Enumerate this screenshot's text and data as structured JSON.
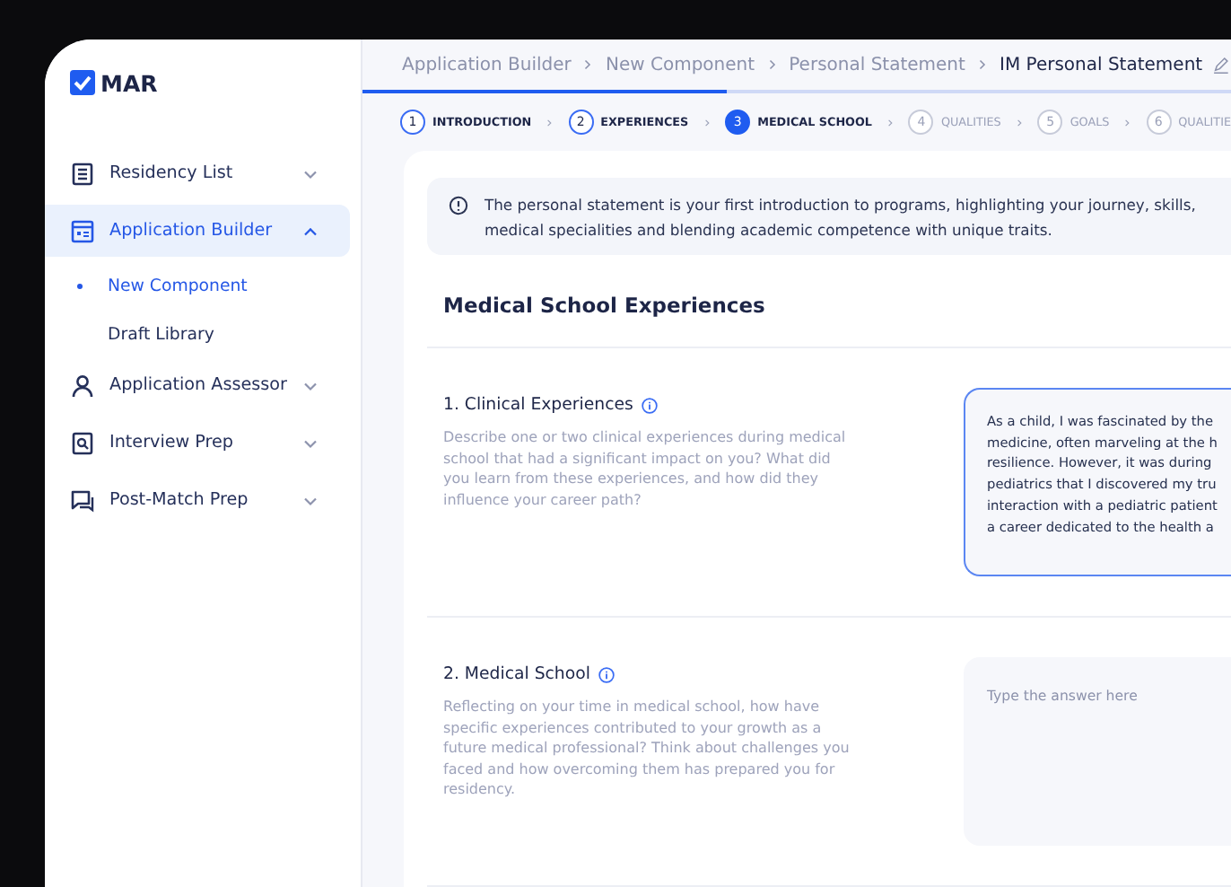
{
  "logo": {
    "text": "MAR"
  },
  "sidebar": {
    "items": [
      {
        "label": "Residency List",
        "kind": "list",
        "expanded": false,
        "selected": false
      },
      {
        "label": "Application Builder",
        "kind": "builder",
        "expanded": true,
        "selected": true,
        "children": [
          {
            "label": "New Component",
            "selected": true
          },
          {
            "label": "Draft Library",
            "selected": false
          }
        ]
      },
      {
        "label": "Application Assessor",
        "kind": "person",
        "expanded": false,
        "selected": false
      },
      {
        "label": "Interview Prep",
        "kind": "review",
        "expanded": false,
        "selected": false
      },
      {
        "label": "Post-Match Prep",
        "kind": "chat",
        "expanded": false,
        "selected": false
      }
    ]
  },
  "breadcrumb": [
    "Application Builder",
    "New Component",
    "Personal Statement",
    "IM Personal Statement"
  ],
  "progress": {
    "level": 0.42
  },
  "steps": [
    {
      "number": "1",
      "label": "INTRODUCTION",
      "completed": true,
      "selected": false
    },
    {
      "number": "2",
      "label": "EXPERIENCES",
      "completed": true,
      "selected": false
    },
    {
      "number": "3",
      "label": "MEDICAL SCHOOL",
      "completed": false,
      "selected": true
    },
    {
      "number": "4",
      "label": "QUALITIES",
      "completed": false,
      "selected": false
    },
    {
      "number": "5",
      "label": "GOALS",
      "completed": false,
      "selected": false
    },
    {
      "number": "6",
      "label": "QUALITIE",
      "completed": false,
      "selected": false
    }
  ],
  "info": "The personal statement is your first introduction to programs, highlighting your journey, skills,",
  "info_line_2": "medical specialities and blending academic competence with unique traits.",
  "section_title": "Medical School Experiences",
  "questions": [
    {
      "title": "1. Clinical Experiences",
      "description": "Describe one or two clinical experiences during medical school that had a significant impact on you? What did you learn from these experiences, and how did they influence your career path?",
      "focused": true,
      "answer_lines": [
        "As a child, I was fascinated by the",
        "medicine, often marveling at the h",
        "resilience. However, it was during",
        "pediatrics that I discovered my tru",
        "interaction with a pediatric patient",
        "a career dedicated to the health a"
      ]
    },
    {
      "title": "2. Medical School",
      "description": "Reflecting on your time in medical school, how have specific experiences contributed to your growth as a future medical professional? Think about challenges you faced and how overcoming them has prepared you for residency.",
      "focused": false,
      "placeholder": "Type the answer here"
    }
  ]
}
